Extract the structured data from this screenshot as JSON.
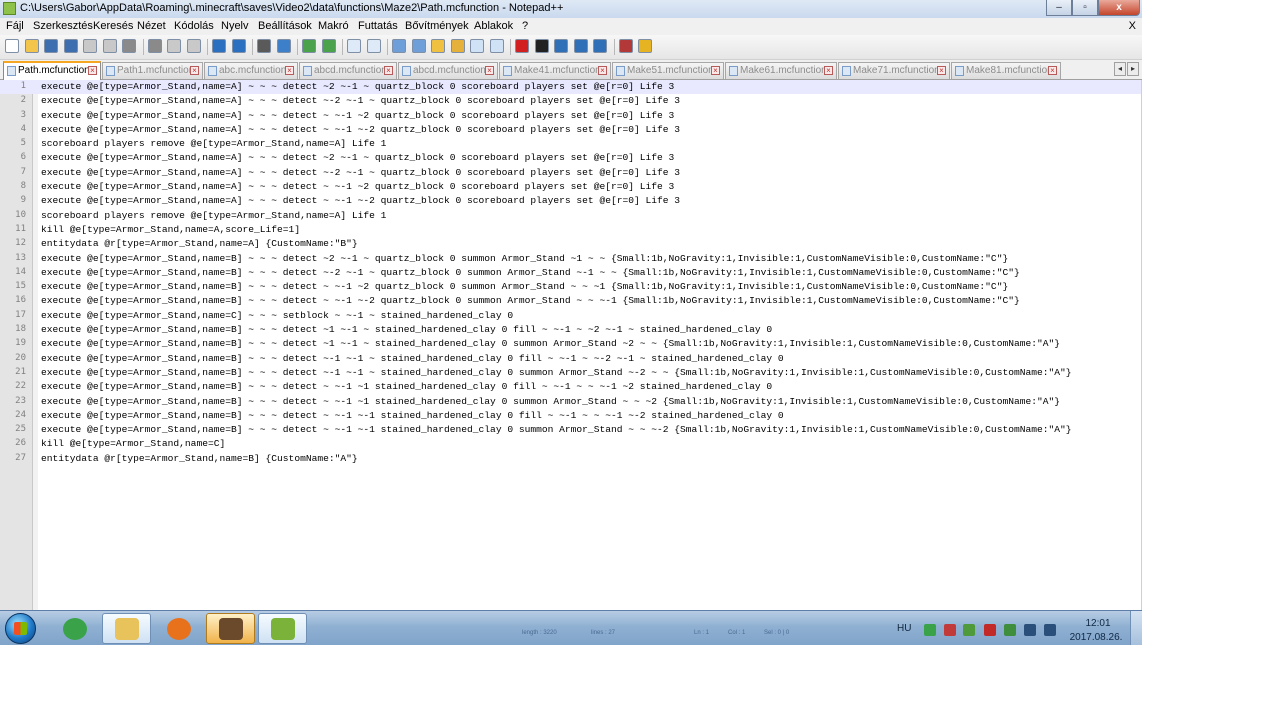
{
  "window": {
    "title": "C:\\Users\\Gabor\\AppData\\Roaming\\.minecraft\\saves\\Video2\\data\\functions\\Maze2\\Path.mcfunction - Notepad++",
    "minimize_label": "–",
    "restore_label": "▫",
    "close_label": "x"
  },
  "menu": {
    "items": [
      "Fájl",
      "Szerkesztés",
      "Keresés",
      "Nézet",
      "Kódolás",
      "Nyelv",
      "Beállítások",
      "Makró",
      "Futtatás",
      "Bővítmények",
      "Ablakok",
      "?"
    ],
    "close_doc_label": "X"
  },
  "toolbar": {
    "icons": [
      "new-file-icon",
      "open-file-icon",
      "save-icon",
      "save-all-icon",
      "close-icon",
      "close-all-icon",
      "print-icon",
      "cut-icon",
      "copy-icon",
      "paste-icon",
      "undo-icon",
      "redo-icon",
      "find-icon",
      "replace-icon",
      "zoom-in-icon",
      "zoom-out-icon",
      "sync-vertical-icon",
      "sync-horizontal-icon",
      "word-wrap-icon",
      "show-all-chars-icon",
      "indent-guide-icon",
      "doc-map-icon",
      "function-list-icon",
      "folder-workspace-icon",
      "record-macro-icon",
      "stop-record-icon",
      "play-macro-icon",
      "run-macro-multiple-icon",
      "save-macro-icon",
      "spell-check-icon",
      "change-dictionary-icon"
    ],
    "accent_colors": {
      "red": "#d21f1f",
      "blue": "#2f6fb8",
      "green": "#3a9b3a",
      "yellow": "#e6b422"
    }
  },
  "tabs": [
    {
      "label": "Path.mcfunction",
      "active": true
    },
    {
      "label": "Path1.mcfunction",
      "active": false
    },
    {
      "label": "abc.mcfunction",
      "active": false
    },
    {
      "label": "abcd.mcfunction",
      "active": false
    },
    {
      "label": "abcd.mcfunction",
      "active": false
    },
    {
      "label": "Make41.mcfunction",
      "active": false
    },
    {
      "label": "Make51.mcfunction",
      "active": false
    },
    {
      "label": "Make61.mcfunction",
      "active": false
    },
    {
      "label": "Make71.mcfunction",
      "active": false
    },
    {
      "label": "Make81.mcfunction",
      "active": false
    }
  ],
  "tab_scroll": {
    "left": "◂",
    "right": "▸"
  },
  "editor": {
    "current_line": 1,
    "lines": [
      "execute @e[type=Armor_Stand,name=A] ~ ~ ~ detect ~2 ~-1 ~ quartz_block 0 scoreboard players set @e[r=0] Life 3",
      "execute @e[type=Armor_Stand,name=A] ~ ~ ~ detect ~-2 ~-1 ~ quartz_block 0 scoreboard players set @e[r=0] Life 3",
      "execute @e[type=Armor_Stand,name=A] ~ ~ ~ detect ~ ~-1 ~2 quartz_block 0 scoreboard players set @e[r=0] Life 3",
      "execute @e[type=Armor_Stand,name=A] ~ ~ ~ detect ~ ~-1 ~-2 quartz_block 0 scoreboard players set @e[r=0] Life 3",
      "scoreboard players remove @e[type=Armor_Stand,name=A] Life 1",
      "execute @e[type=Armor_Stand,name=A] ~ ~ ~ detect ~2 ~-1 ~ quartz_block 0 scoreboard players set @e[r=0] Life 3",
      "execute @e[type=Armor_Stand,name=A] ~ ~ ~ detect ~-2 ~-1 ~ quartz_block 0 scoreboard players set @e[r=0] Life 3",
      "execute @e[type=Armor_Stand,name=A] ~ ~ ~ detect ~ ~-1 ~2 quartz_block 0 scoreboard players set @e[r=0] Life 3",
      "execute @e[type=Armor_Stand,name=A] ~ ~ ~ detect ~ ~-1 ~-2 quartz_block 0 scoreboard players set @e[r=0] Life 3",
      "scoreboard players remove @e[type=Armor_Stand,name=A] Life 1",
      "kill @e[type=Armor_Stand,name=A,score_Life=1]",
      "entitydata @r[type=Armor_Stand,name=A] {CustomName:\"B\"}",
      "execute @e[type=Armor_Stand,name=B] ~ ~ ~ detect ~2 ~-1 ~ quartz_block 0 summon Armor_Stand ~1 ~ ~ {Small:1b,NoGravity:1,Invisible:1,CustomNameVisible:0,CustomName:\"C\"}",
      "execute @e[type=Armor_Stand,name=B] ~ ~ ~ detect ~-2 ~-1 ~ quartz_block 0 summon Armor_Stand ~-1 ~ ~ {Small:1b,NoGravity:1,Invisible:1,CustomNameVisible:0,CustomName:\"C\"}",
      "execute @e[type=Armor_Stand,name=B] ~ ~ ~ detect ~ ~-1 ~2 quartz_block 0 summon Armor_Stand ~ ~ ~1 {Small:1b,NoGravity:1,Invisible:1,CustomNameVisible:0,CustomName:\"C\"}",
      "execute @e[type=Armor_Stand,name=B] ~ ~ ~ detect ~ ~-1 ~-2 quartz_block 0 summon Armor_Stand ~ ~ ~-1 {Small:1b,NoGravity:1,Invisible:1,CustomNameVisible:0,CustomName:\"C\"}",
      "execute @e[type=Armor_Stand,name=C] ~ ~ ~ setblock ~ ~-1 ~ stained_hardened_clay 0",
      "execute @e[type=Armor_Stand,name=B] ~ ~ ~ detect ~1 ~-1 ~ stained_hardened_clay 0 fill ~ ~-1 ~ ~2 ~-1 ~ stained_hardened_clay 0",
      "execute @e[type=Armor_Stand,name=B] ~ ~ ~ detect ~1 ~-1 ~ stained_hardened_clay 0 summon Armor_Stand ~2 ~ ~ {Small:1b,NoGravity:1,Invisible:1,CustomNameVisible:0,CustomName:\"A\"}",
      "execute @e[type=Armor_Stand,name=B] ~ ~ ~ detect ~-1 ~-1 ~ stained_hardened_clay 0 fill ~ ~-1 ~ ~-2 ~-1 ~ stained_hardened_clay 0",
      "execute @e[type=Armor_Stand,name=B] ~ ~ ~ detect ~-1 ~-1 ~ stained_hardened_clay 0 summon Armor_Stand ~-2 ~ ~ {Small:1b,NoGravity:1,Invisible:1,CustomNameVisible:0,CustomName:\"A\"}",
      "execute @e[type=Armor_Stand,name=B] ~ ~ ~ detect ~ ~-1 ~1 stained_hardened_clay 0 fill ~ ~-1 ~ ~ ~-1 ~2 stained_hardened_clay 0",
      "execute @e[type=Armor_Stand,name=B] ~ ~ ~ detect ~ ~-1 ~1 stained_hardened_clay 0 summon Armor_Stand ~ ~ ~2 {Small:1b,NoGravity:1,Invisible:1,CustomNameVisible:0,CustomName:\"A\"}",
      "execute @e[type=Armor_Stand,name=B] ~ ~ ~ detect ~ ~-1 ~-1 stained_hardened_clay 0 fill ~ ~-1 ~ ~ ~-1 ~-2 stained_hardened_clay 0",
      "execute @e[type=Armor_Stand,name=B] ~ ~ ~ detect ~ ~-1 ~-1 stained_hardened_clay 0 summon Armor_Stand ~ ~ ~-2 {Small:1b,NoGravity:1,Invisible:1,CustomNameVisible:0,CustomName:\"A\"}",
      "kill @e[type=Armor_Stand,name=C]",
      "entitydata @r[type=Armor_Stand,name=B] {CustomName:\"A\"}"
    ]
  },
  "taskbar": {
    "apps": [
      {
        "name": "utorrent",
        "icon": "utorrent-icon",
        "state": "pinned",
        "color": "#3aa34a"
      },
      {
        "name": "explorer",
        "icon": "folder-icon",
        "state": "open",
        "color": "#e8c25a"
      },
      {
        "name": "firefox",
        "icon": "firefox-icon",
        "state": "pinned",
        "color": "#e8721c"
      },
      {
        "name": "minecraft",
        "icon": "minecraft-icon",
        "state": "active",
        "color": "#6b4a2b"
      },
      {
        "name": "notepad++",
        "icon": "notepadpp-icon",
        "state": "open",
        "color": "#7bb33a"
      }
    ],
    "status_ghost": [
      "length : 3220",
      "lines : 27",
      "Ln : 1",
      "Col : 1",
      "Sel : 0 | 0"
    ],
    "language": "HU",
    "tray_icons": [
      {
        "name": "utorrent-tray-icon",
        "color": "#3aa34a"
      },
      {
        "name": "bluetooth-tray-icon",
        "color": "#c23b3b"
      },
      {
        "name": "sync-tray-icon",
        "color": "#4f9a3a"
      },
      {
        "name": "security-tray-icon",
        "color": "#c22a2a"
      },
      {
        "name": "shield-tray-icon",
        "color": "#3e8e3e"
      },
      {
        "name": "network-tray-icon",
        "color": "#2a4f7a"
      },
      {
        "name": "volume-tray-icon",
        "color": "#2a4f7a"
      }
    ],
    "time": "12:01",
    "date": "2017.08.26."
  }
}
